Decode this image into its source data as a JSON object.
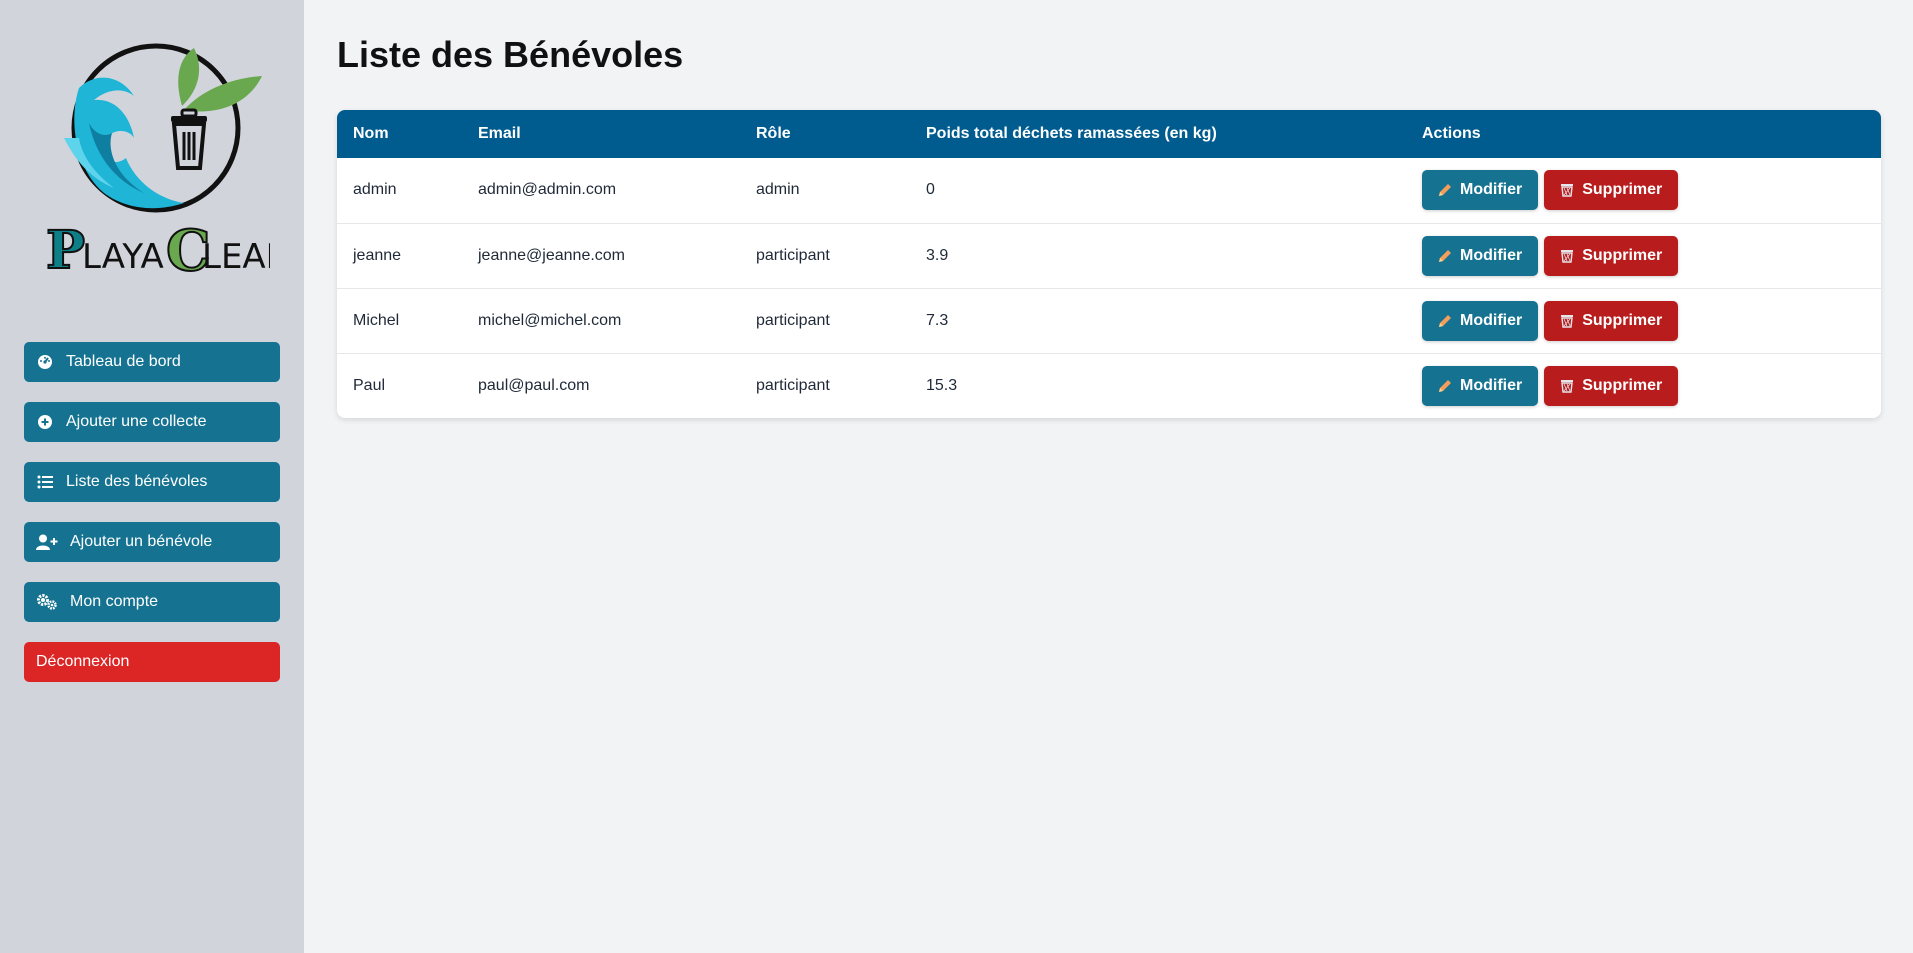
{
  "sidebar": {
    "logo_text": "PlayaClean",
    "items": [
      {
        "label": "Tableau de bord",
        "icon": "dashboard-gauge-icon"
      },
      {
        "label": "Ajouter une collecte",
        "icon": "plus-circle-icon"
      },
      {
        "label": "Liste des bénévoles",
        "icon": "list-icon"
      },
      {
        "label": "Ajouter un bénévole",
        "icon": "user-plus-icon"
      },
      {
        "label": "Mon compte",
        "icon": "gears-icon"
      }
    ],
    "logout_label": "Déconnexion"
  },
  "main": {
    "title": "Liste des Bénévoles",
    "table": {
      "headers": [
        "Nom",
        "Email",
        "Rôle",
        "Poids total déchets ramassées (en kg)",
        "Actions"
      ],
      "rows": [
        {
          "nom": "admin",
          "email": "admin@admin.com",
          "role": "admin",
          "poids": "0"
        },
        {
          "nom": "jeanne",
          "email": "jeanne@jeanne.com",
          "role": "participant",
          "poids": "3.9"
        },
        {
          "nom": "Michel",
          "email": "michel@michel.com",
          "role": "participant",
          "poids": "7.3"
        },
        {
          "nom": "Paul",
          "email": "paul@paul.com",
          "role": "participant",
          "poids": "15.3"
        }
      ],
      "edit_label": "Modifier",
      "delete_label": "Supprimer"
    }
  },
  "colors": {
    "sidebar_bg": "#d1d5db",
    "primary": "#157391",
    "header_bg": "#005b8f",
    "danger": "#b91c1c",
    "logout": "#dc2626",
    "page_bg": "#f2f3f5"
  }
}
